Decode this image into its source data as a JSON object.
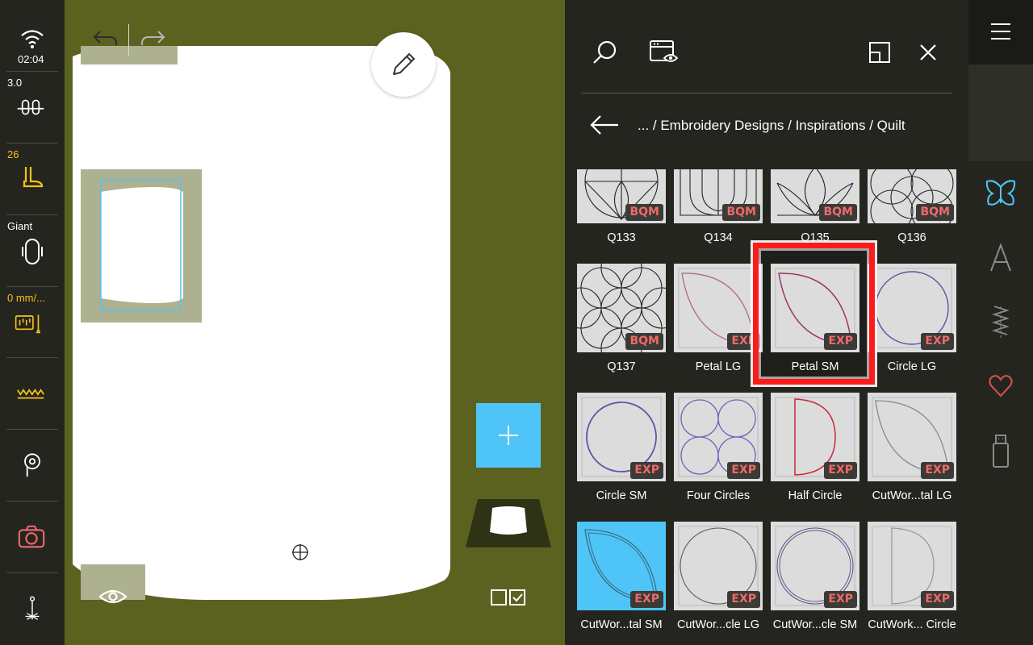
{
  "status": {
    "time": "02:04",
    "stitch_length": "3.0",
    "speed": "26",
    "hoop": "Giant",
    "feed": "0 mm/..."
  },
  "toolbar": {
    "undo_label": "undo",
    "redo_label": "redo"
  },
  "panel": {
    "breadcrumb": "... / Embroidery Designs / Inspirations / Quilt",
    "tiles": [
      {
        "label": "Q133",
        "badge": "BQM"
      },
      {
        "label": "Q134",
        "badge": "BQM"
      },
      {
        "label": "Q135",
        "badge": "BQM"
      },
      {
        "label": "Q136",
        "badge": "BQM"
      },
      {
        "label": "Q137",
        "badge": "BQM"
      },
      {
        "label": "Petal LG",
        "badge": "EXP"
      },
      {
        "label": "Petal SM",
        "badge": "EXP"
      },
      {
        "label": "Circle LG",
        "badge": "EXP"
      },
      {
        "label": "Circle SM",
        "badge": "EXP"
      },
      {
        "label": "Four Circles",
        "badge": "EXP"
      },
      {
        "label": "Half Circle",
        "badge": "EXP"
      },
      {
        "label": "CutWor...tal LG",
        "badge": "EXP"
      },
      {
        "label": "CutWor...tal SM",
        "badge": "EXP"
      },
      {
        "label": "CutWor...cle LG",
        "badge": "EXP"
      },
      {
        "label": "CutWor...cle SM",
        "badge": "EXP"
      },
      {
        "label": "CutWork... Circle",
        "badge": "EXP"
      }
    ]
  },
  "colors": {
    "accent": "#4fc5f7",
    "highlight": "#ff1a1a",
    "warning": "#f4c21b",
    "badge_text": "#f06a6a"
  },
  "icons": [
    "wifi-icon",
    "stitch-tension-icon",
    "presser-foot-icon",
    "hoop-icon",
    "feed-pencil-icon",
    "zigzag-icon",
    "bobbin-icon",
    "camera-icon",
    "needle-position-icon",
    "undo-icon",
    "redo-icon",
    "pencil-icon",
    "eye-icon",
    "crosshair-icon",
    "plus-icon",
    "select-icon",
    "search-icon",
    "preview-icon",
    "resize-icon",
    "close-icon",
    "back-arrow-icon",
    "menu-icon",
    "butterfly-icon",
    "letter-icon",
    "stitch-icon",
    "heart-icon",
    "usb-icon"
  ]
}
